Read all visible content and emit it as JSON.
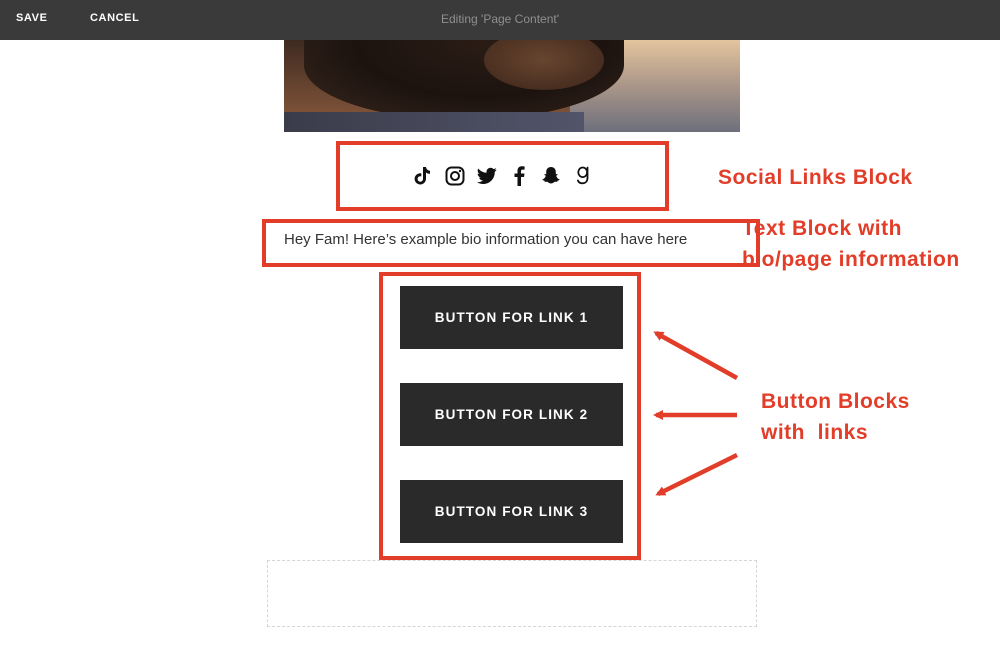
{
  "toolbar": {
    "save_label": "SAVE",
    "cancel_label": "CANCEL",
    "title": "Editing 'Page Content'"
  },
  "social_links": {
    "icons": [
      "tiktok-icon",
      "instagram-icon",
      "twitter-icon",
      "facebook-icon",
      "snapchat-icon",
      "goodreads-icon"
    ]
  },
  "bio": {
    "text": "Hey Fam! Here’s example bio information you can have here"
  },
  "buttons": [
    {
      "label": "BUTTON FOR LINK 1"
    },
    {
      "label": "BUTTON FOR LINK 2"
    },
    {
      "label": "BUTTON FOR LINK 3"
    }
  ],
  "annotations": {
    "social_label": "Social Links Block",
    "text_label_line1": "Text Block with",
    "text_label_line2": "bio/page information",
    "button_label_line1": "Button Blocks",
    "button_label_line2": "with  links",
    "color": "#e23d28"
  }
}
